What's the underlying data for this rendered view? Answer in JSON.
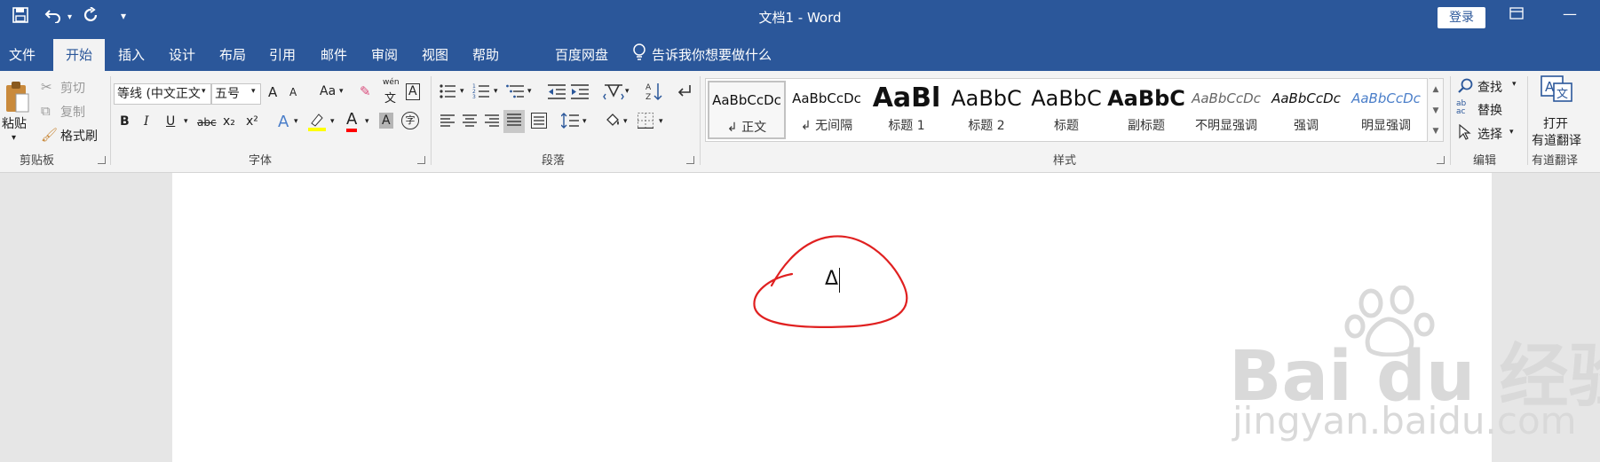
{
  "title_bar": {
    "title": "文档1  -  Word",
    "login_label": "登录",
    "quick_access": [
      "save-icon",
      "undo-icon",
      "redo-icon",
      "customize-icon"
    ],
    "bg_color": "#2b579a"
  },
  "tabs": [
    {
      "label": "文件"
    },
    {
      "label": "开始",
      "active": true
    },
    {
      "label": "插入"
    },
    {
      "label": "设计"
    },
    {
      "label": "布局"
    },
    {
      "label": "引用"
    },
    {
      "label": "邮件"
    },
    {
      "label": "审阅"
    },
    {
      "label": "视图"
    },
    {
      "label": "帮助"
    },
    {
      "label": "百度网盘"
    },
    {
      "label": "告诉我你想要做什么"
    }
  ],
  "clipboard": {
    "paste_label": "粘贴",
    "cut_label": "剪切",
    "copy_label": "复制",
    "format_painter_label": "格式刷",
    "group_label": "剪贴板"
  },
  "font": {
    "font_name": "等线 (中文正文",
    "font_size": "五号",
    "group_label": "字体",
    "pinyin_label": "wén",
    "pinyin_char": "文",
    "change_case_label": "Aa",
    "bold": "B",
    "italic": "I",
    "underline": "U",
    "strike": "abc",
    "subscript": "x₂",
    "superscript": "x²",
    "grow_label": "A",
    "shrink_label": "A",
    "text_effects": "A",
    "font_color": "A",
    "char_shading": "A",
    "char_border": "A",
    "enclose_char": "字",
    "font_color_hex": "#ff0000",
    "highlight_color_hex": "#ffff00"
  },
  "paragraph": {
    "group_label": "段落"
  },
  "styles": {
    "group_label": "样式",
    "items": [
      {
        "sample": "AaBbCcDc",
        "name": "↲ 正文"
      },
      {
        "sample": "AaBbCcDc",
        "name": "↲ 无间隔"
      },
      {
        "sample": "AaBl",
        "name": "标题 1"
      },
      {
        "sample": "AaBbC",
        "name": "标题 2"
      },
      {
        "sample": "AaBbC",
        "name": "标题"
      },
      {
        "sample": "AaBbC",
        "name": "副标题"
      },
      {
        "sample": "AaBbCcDc",
        "name": "不明显强调"
      },
      {
        "sample": "AaBbCcDc",
        "name": "强调"
      },
      {
        "sample": "AaBbCcDc",
        "name": "明显强调"
      }
    ]
  },
  "editing": {
    "find_label": "查找",
    "replace_label": "替换",
    "select_label": "选择",
    "group_label": "编辑"
  },
  "youdao": {
    "open_label_1": "打开",
    "open_label_2": "有道翻译",
    "group_label": "有道翻译"
  },
  "document": {
    "text": "Δ",
    "annotation_color": "#e02020"
  },
  "watermark": {
    "main": "Bai du 经验",
    "sub": "jingyan.baidu.com"
  }
}
